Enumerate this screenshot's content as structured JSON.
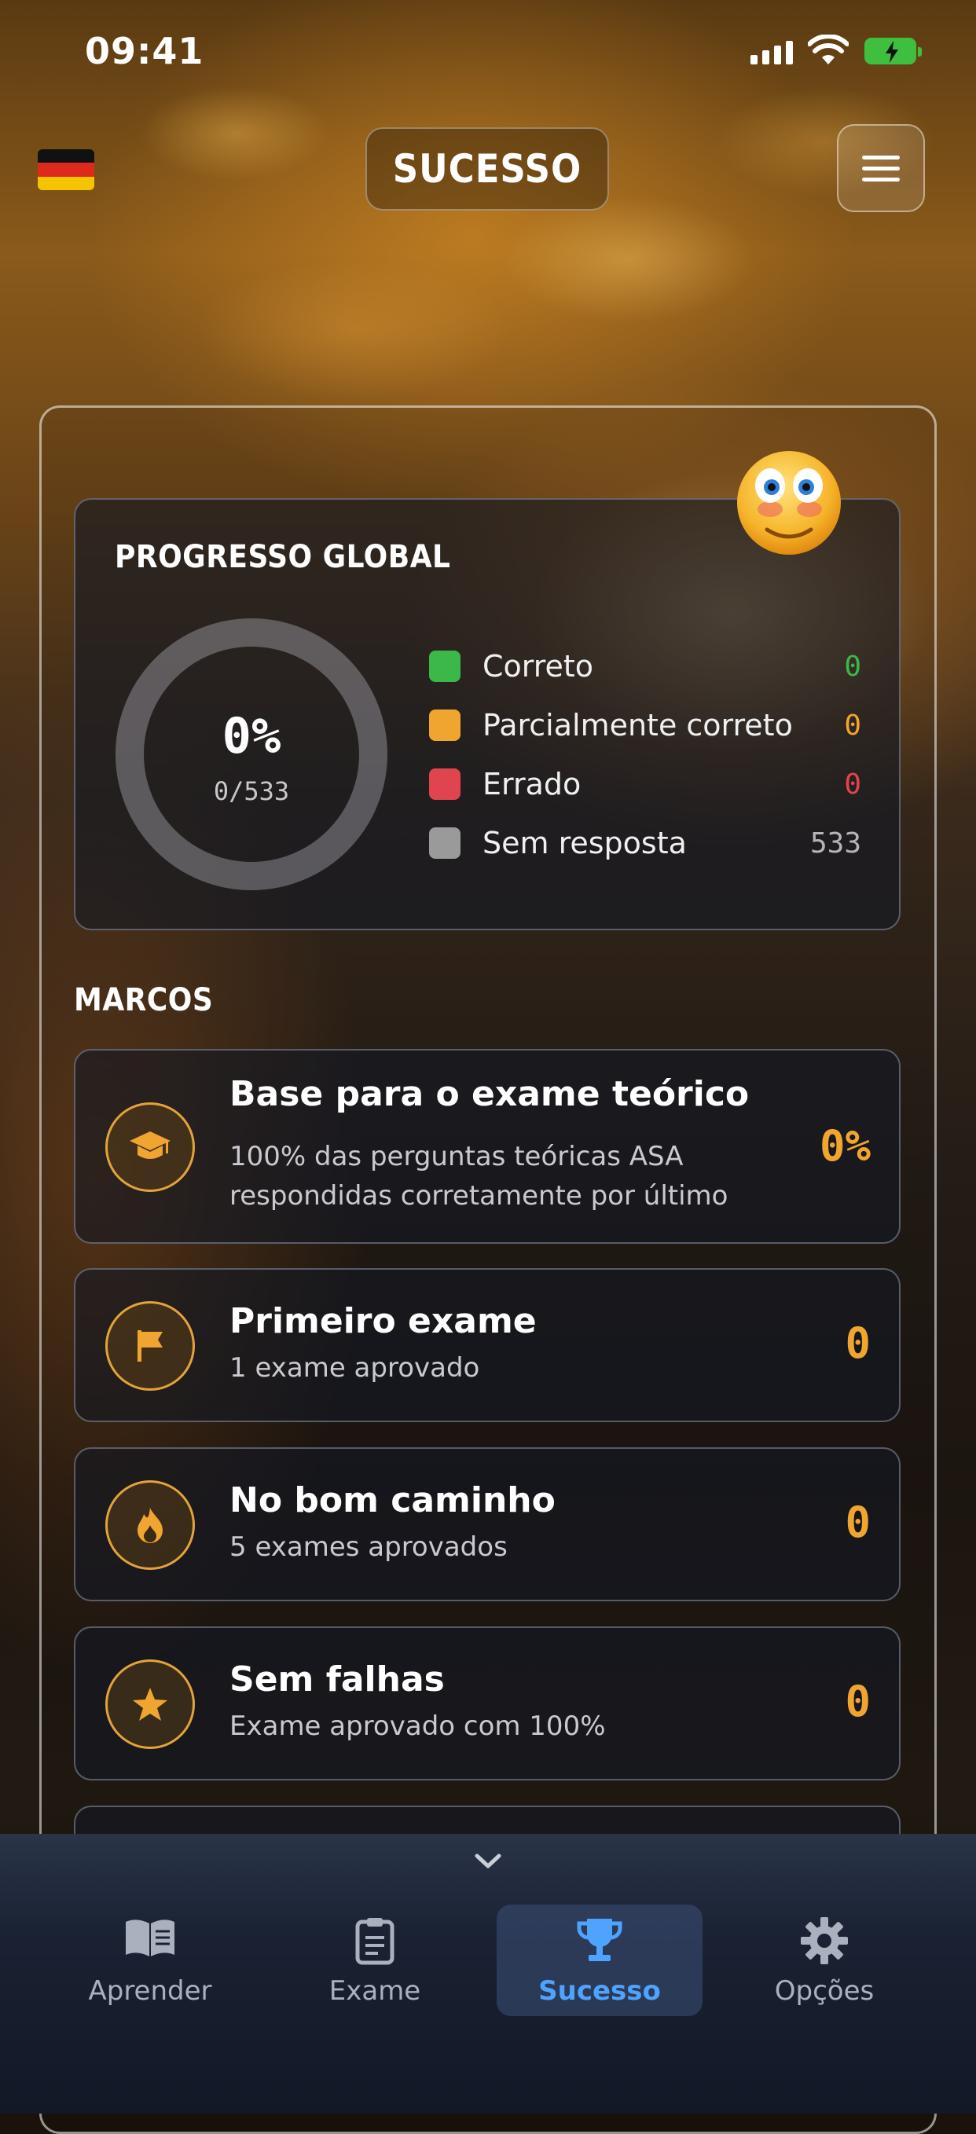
{
  "status_bar": {
    "time": "09:41"
  },
  "header": {
    "title": "SUCESSO",
    "language_flag": "german-flag",
    "menu_icon": "hamburger-menu-icon"
  },
  "progress": {
    "title": "PROGRESSO GLOBAL",
    "percent_label": "0%",
    "fraction_label": "0/533",
    "completed_fraction": 0,
    "legend": [
      {
        "label": "Correto",
        "count": "0",
        "color": "#3cb84a"
      },
      {
        "label": "Parcialmente correto",
        "count": "0",
        "color": "#f0a531"
      },
      {
        "label": "Errado",
        "count": "0",
        "color": "#e0454f"
      },
      {
        "label": "Sem resposta",
        "count": "533",
        "color": "#9a9a9a"
      }
    ]
  },
  "milestones": {
    "title": "MARCOS",
    "items": [
      {
        "icon": "graduation-cap-icon",
        "title": "Base para o exame teórico",
        "desc": "100% das perguntas teóricas ASA respondidas corretamente por último",
        "value": "0%"
      },
      {
        "icon": "flag-icon",
        "title": "Primeiro exame",
        "desc": "1 exame aprovado",
        "value": "0"
      },
      {
        "icon": "flame-icon",
        "title": "No bom caminho",
        "desc": "5 exames aprovados",
        "value": "0"
      },
      {
        "icon": "star-icon",
        "title": "Sem falhas",
        "desc": "Exame aprovado com 100%",
        "value": "0"
      }
    ]
  },
  "nav": {
    "items": [
      {
        "label": "Aprender",
        "icon": "book-icon"
      },
      {
        "label": "Exame",
        "icon": "clipboard-icon"
      },
      {
        "label": "Sucesso",
        "icon": "trophy-icon",
        "active": true
      },
      {
        "label": "Opções",
        "icon": "gear-icon"
      }
    ]
  },
  "colors": {
    "accent": "#f0a531",
    "active_nav": "#4ea3ff"
  }
}
